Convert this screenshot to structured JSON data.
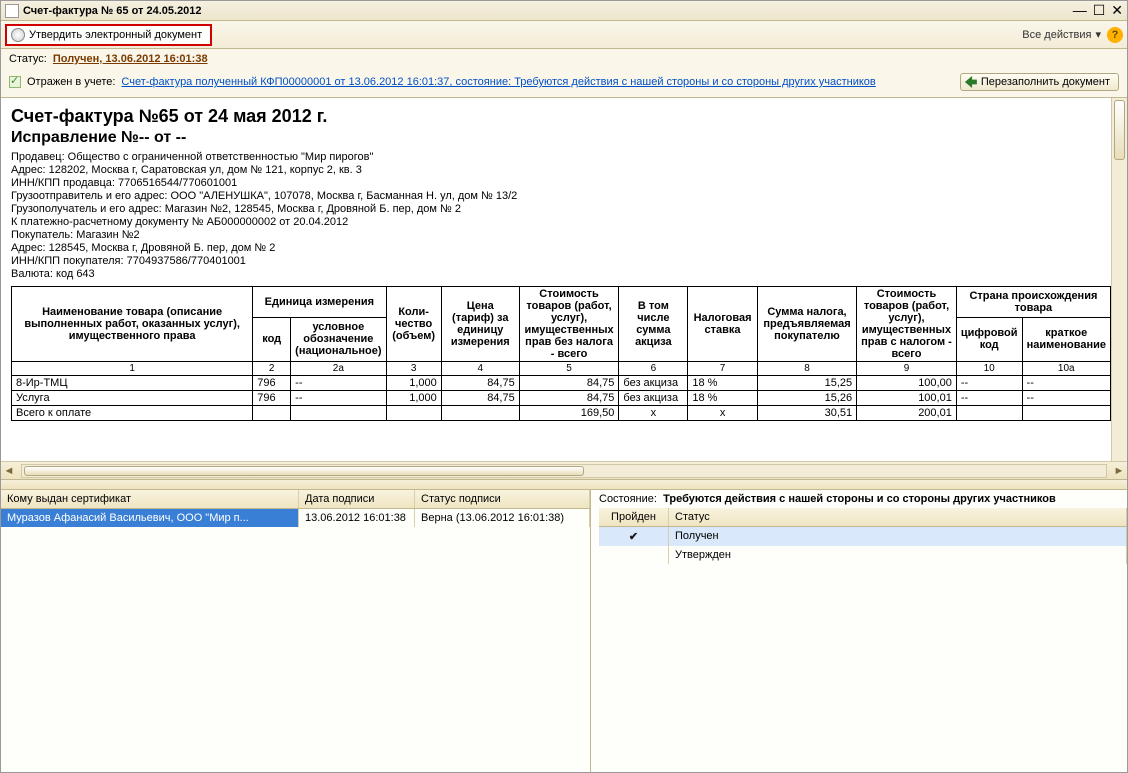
{
  "window_title": "Счет-фактура № 65 от 24.05.2012",
  "toolbar": {
    "approve_label": "Утвердить электронный документ",
    "all_actions": "Все действия"
  },
  "status": {
    "label": "Статус:",
    "value": "Получен, 13.06.2012 16:01:38"
  },
  "reflected": {
    "label": "Отражен в учете:",
    "link": "Счет-фактура полученный КФП00000001 от 13.06.2012 16:01:37, состояние: Требуются действия с нашей стороны и со стороны других участников",
    "refill": "Перезаполнить документ"
  },
  "doc": {
    "title1": "Счет-фактура №65 от 24 мая 2012 г.",
    "title2": "Исправление №-- от --",
    "seller": "Продавец: Общество с ограниченной ответственностью \"Мир пирогов\"",
    "seller_addr": "Адрес: 128202, Москва г, Саратовская ул, дом № 121, корпус 2, кв. 3",
    "seller_inn": "ИНН/КПП продавца: 7706516544/770601001",
    "shipper": "Грузоотправитель и его адрес: ООО \"АЛЕНУШКА\", 107078, Москва г, Басманная Н. ул, дом № 13/2",
    "consignee": "Грузополучатель и его адрес: Магазин №2, 128545, Москва г, Дровяной Б. пер, дом № 2",
    "payment": "К платежно-расчетному документу № АБ000000002 от 20.04.2012",
    "buyer": "Покупатель: Магазин №2",
    "buyer_addr": "Адрес: 128545, Москва г, Дровяной Б. пер, дом № 2",
    "buyer_inn": "ИНН/КПП покупателя: 7704937586/770401001",
    "currency": "Валюта: код 643"
  },
  "table": {
    "headers": {
      "name": "Наименование товара (описание выполненных работ, оказанных услуг), имущественного права",
      "unit": "Единица измерения",
      "code": "код",
      "unit_name": "условное обозначение (национальное)",
      "qty": "Коли-чество (объем)",
      "price": "Цена (тариф) за единицу измерения",
      "cost_no_tax": "Стоимость товаров (работ, услуг), имущественных прав без налога - всего",
      "excise": "В том числе сумма акциза",
      "tax_rate": "Налоговая ставка",
      "tax_sum": "Сумма налога, предъявляемая покупателю",
      "cost_tax": "Стоимость товаров (работ, услуг), имущественных прав с налогом - всего",
      "country": "Страна происхождения товара",
      "country_code": "цифровой код",
      "country_name": "краткое наименование"
    },
    "nums": [
      "1",
      "2",
      "2а",
      "3",
      "4",
      "5",
      "6",
      "7",
      "8",
      "9",
      "10",
      "10а"
    ],
    "rows": [
      {
        "name": "8-Ир-ТМЦ",
        "code": "796",
        "unit": "--",
        "qty": "1,000",
        "price": "84,75",
        "cost": "84,75",
        "excise": "без акциза",
        "rate": "18 %",
        "tax": "15,25",
        "total": "100,00",
        "cc": "--",
        "cn": "--"
      },
      {
        "name": "Услуга",
        "code": "796",
        "unit": "--",
        "qty": "1,000",
        "price": "84,75",
        "cost": "84,75",
        "excise": "без акциза",
        "rate": "18 %",
        "tax": "15,26",
        "total": "100,01",
        "cc": "--",
        "cn": "--"
      }
    ],
    "total": {
      "name": "Всего к оплате",
      "cost": "169,50",
      "tax": "30,51",
      "total": "200,01",
      "x1": "x",
      "x2": "x"
    }
  },
  "cert": {
    "col_who": "Кому выдан сертификат",
    "col_date": "Дата подписи",
    "col_status": "Статус подписи",
    "row": {
      "who": "Муразов Афанасий Васильевич, ООО \"Мир п...",
      "date": "13.06.2012 16:01:38",
      "status": "Верна (13.06.2012 16:01:38)"
    }
  },
  "state": {
    "label": "Состояние:",
    "value": "Требуются действия с нашей стороны и со стороны других участников",
    "col_pass": "Пройден",
    "col_stat": "Статус",
    "rows": [
      {
        "pass": "✔",
        "status": "Получен"
      },
      {
        "pass": "",
        "status": "Утвержден"
      }
    ]
  }
}
